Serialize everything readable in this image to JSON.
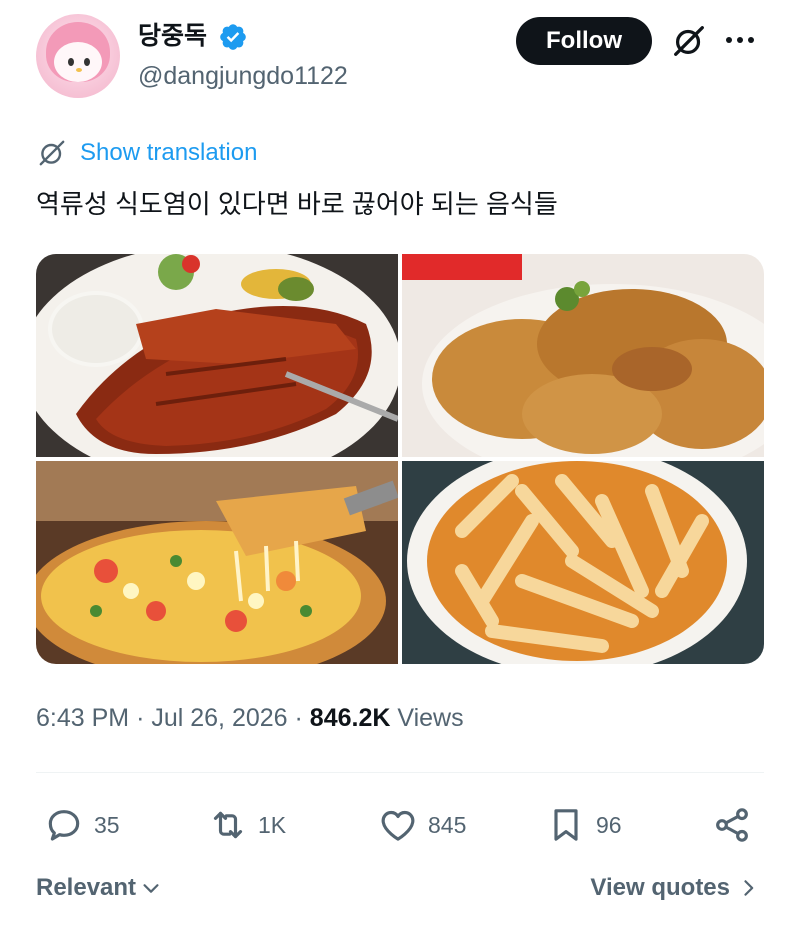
{
  "user": {
    "display_name": "당중독",
    "handle": "@dangjungdo1122",
    "verified": true
  },
  "header": {
    "follow_label": "Follow",
    "grok_icon": "grok-icon",
    "more_icon": "more-icon"
  },
  "translation": {
    "label": "Show translation"
  },
  "tweet": {
    "text": "역류성 식도염이 있다면 바로 끊어야 되는 음식들"
  },
  "media": [
    {
      "icon": "pork-cutlet-photo"
    },
    {
      "icon": "fried-chicken-photo"
    },
    {
      "icon": "pizza-photo"
    },
    {
      "icon": "tteokbokki-photo"
    }
  ],
  "meta": {
    "time": "6:43 PM",
    "separator": "·",
    "date": "Jul 26, 2026",
    "views_count": "846.2K",
    "views_label": "Views"
  },
  "actions": {
    "replies": "35",
    "reposts": "1K",
    "likes": "845",
    "bookmarks": "96"
  },
  "footer": {
    "sort_label": "Relevant",
    "quotes_label": "View quotes"
  },
  "colors": {
    "accent": "#1d9bf0",
    "text": "#0f1419",
    "muted": "#536471",
    "follow_bg": "#0f1419"
  }
}
